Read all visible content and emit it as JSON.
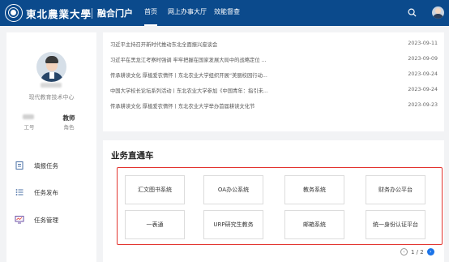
{
  "header": {
    "school_name": "東北農業大學",
    "portal_name": "融合门户",
    "nav": [
      {
        "label": "首页",
        "active": true
      },
      {
        "label": "网上办事大厅",
        "active": false
      },
      {
        "label": "效能督查",
        "active": false
      }
    ],
    "colors": {
      "primary": "#0b4a8c"
    }
  },
  "profile": {
    "org": "现代教育技术中心",
    "stats": [
      {
        "value": "",
        "label": "工号"
      },
      {
        "value": "教师",
        "label": "角色"
      }
    ]
  },
  "side_menu": [
    {
      "label": "填报任务",
      "icon": "form-icon"
    },
    {
      "label": "任务发布",
      "icon": "list-icon"
    },
    {
      "label": "任务管理",
      "icon": "monitor-icon"
    }
  ],
  "news": [
    {
      "title": "习近平主持召开新时代推动东北全面振兴座谈会",
      "date": "2023-09-11"
    },
    {
      "title": "习近平在黑龙江考察时强调 牢牢把握在国家发展大局中的战略定位 ...",
      "date": "2023-09-09"
    },
    {
      "title": "传承耕读文化 厚植爱农情怀丨东北农业大学组织开展“美丽校园行动...",
      "date": "2023-09-24"
    },
    {
      "title": "中国大学校长论坛系列活动丨东北农业大学参加《中国青年：指引未...",
      "date": "2023-09-24"
    },
    {
      "title": "传承耕读文化 厚植爱农情怀丨东北农业大学举办首届耕读文化节",
      "date": "2023-09-23"
    }
  ],
  "business": {
    "title": "业务直通车",
    "tiles": [
      "汇文图书系统",
      "OA办公系统",
      "教务系统",
      "财务办公平台",
      "一表通",
      "URP研究生教务",
      "邮箱系统",
      "统一身份认证平台"
    ],
    "pager": {
      "text": "1 / 2"
    },
    "highlight_color": "#e3342f"
  }
}
